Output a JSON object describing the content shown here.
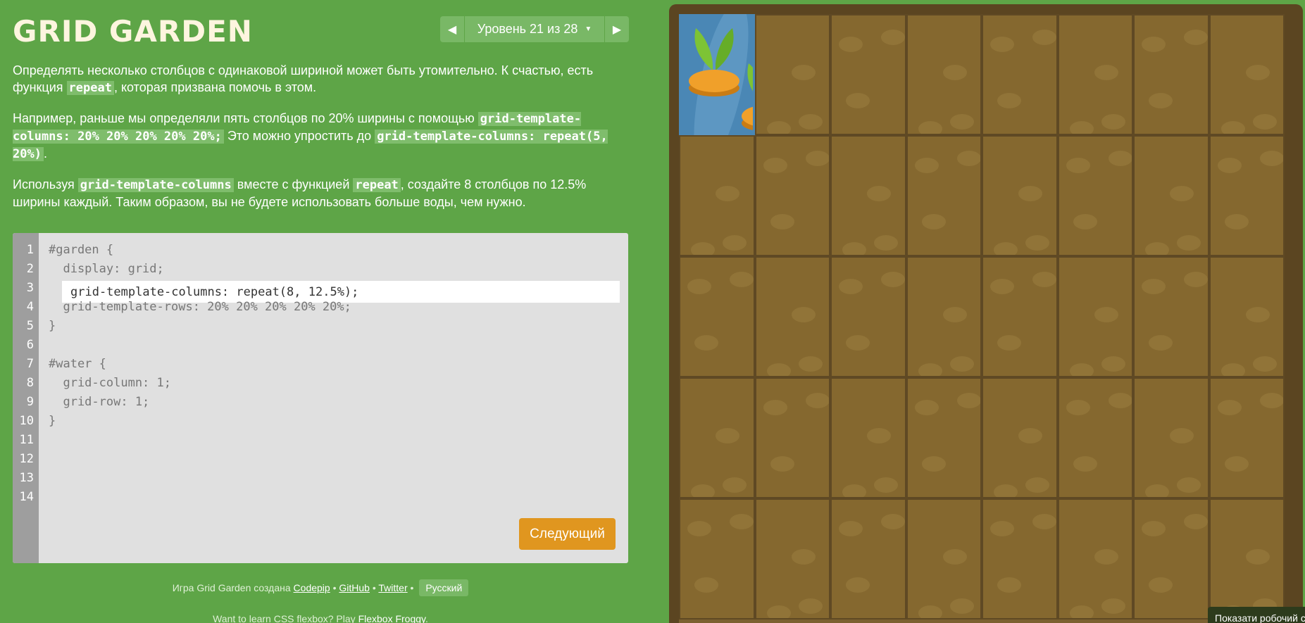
{
  "header": {
    "title": "GRID GARDEN",
    "level_label": "Уровень 21 из 28",
    "prev_icon": "triangle-left",
    "next_icon": "triangle-right",
    "dropdown_icon": "caret-down"
  },
  "description": {
    "p1": {
      "text_a": "Определять несколько столбцов с одинаковой шириной может быть утомительно. К счастью, есть функция ",
      "code_a": "repeat",
      "text_b": ", которая призвана помочь в этом."
    },
    "p2": {
      "text_a": "Например, раньше мы определяли пять столбцов по 20% ширины с помощью ",
      "code_a": "grid-template-columns: 20% 20% 20% 20% 20%;",
      "text_b": " Это можно упростить до ",
      "code_b": "grid-template-columns: repeat(5, 20%)",
      "text_c": "."
    },
    "p3": {
      "text_a": "Используя ",
      "code_a": "grid-template-columns",
      "text_b": " вместе с функцией ",
      "code_b": "repeat",
      "text_c": ", создайте 8 столбцов по 12.5% ширины каждый. Таким образом, вы не будете использовать больше воды, чем нужно."
    }
  },
  "editor": {
    "line_numbers": [
      "1",
      "2",
      "3",
      "4",
      "5",
      "6",
      "7",
      "8",
      "9",
      "10",
      "11",
      "12",
      "13",
      "14"
    ],
    "code_lines": {
      "l1": "#garden {",
      "l2": "  display: grid;",
      "l4": "  grid-template-rows: 20% 20% 20% 20% 20%;",
      "l5": "}",
      "l7": "#water {",
      "l8": "  grid-column: 1;",
      "l9": "  grid-row: 1;",
      "l10": "}"
    },
    "input_value": "grid-template-columns: repeat(8, 12.5%);",
    "next_button": "Следующий"
  },
  "footer": {
    "credits_prefix": "Игра Grid Garden создана",
    "link_codepip": "Codepip",
    "link_github": "GitHub",
    "link_twitter": "Twitter",
    "separator": "•",
    "language": "Русский",
    "promo_prefix": "Want to learn CSS flexbox? Play",
    "promo_link": "Flexbox Froggy",
    "promo_suffix": "."
  },
  "garden": {
    "columns": 8,
    "rows": 5,
    "water_cell": {
      "column": 1,
      "row": 1
    },
    "colors": {
      "soil": "#85682f",
      "frame": "#5b4521",
      "water": "#4a87b5",
      "carrot": "#f0a02a",
      "leaf": "#7dc335"
    }
  },
  "toast": "Показати робочий стіл"
}
